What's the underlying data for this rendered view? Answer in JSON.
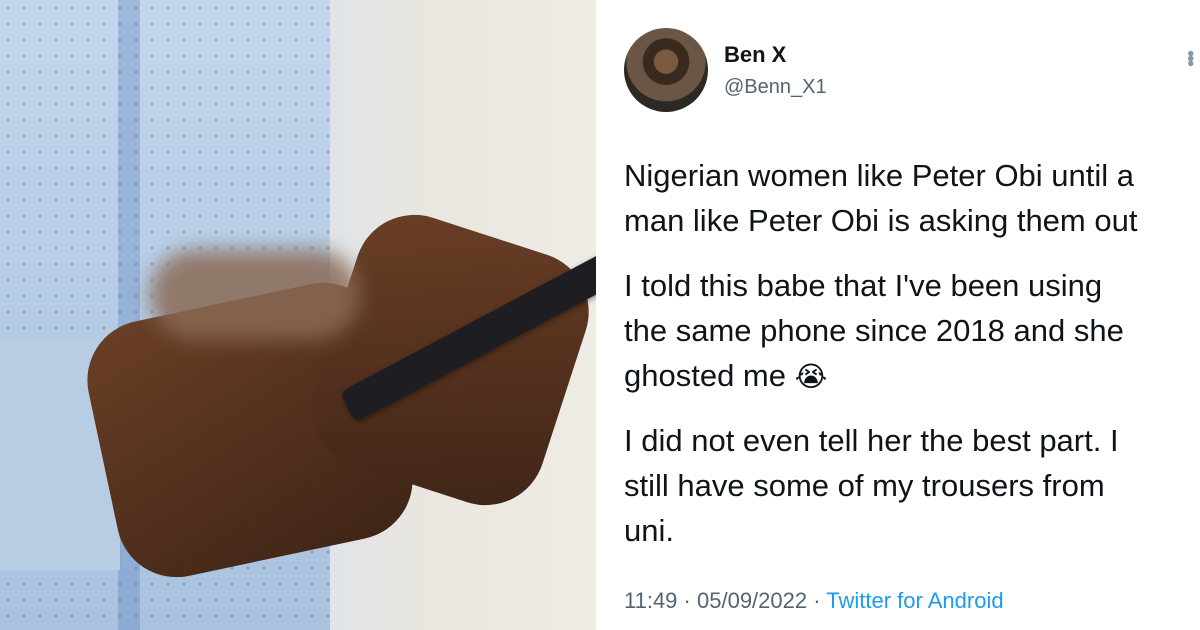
{
  "tweet": {
    "name": "Ben X",
    "handle": "@Benn_X1",
    "paragraphs": [
      [
        "Nigerian women like Peter Obi until a",
        "man like Peter Obi is asking them out"
      ],
      [
        "I told this babe that I've been using",
        "the same phone since 2018 and she",
        "ghosted me"
      ],
      [
        "I did not even tell her the best part. I",
        "still have some of my trousers from",
        "uni."
      ]
    ],
    "emoji": "😭",
    "time": "11:49",
    "separator": "·",
    "date": "05/09/2022",
    "source": "Twitter for Android"
  },
  "colors": {
    "text": "#0f1419",
    "secondary": "#536471",
    "link": "#1d9bf0"
  },
  "icons": {
    "more": "more-options-icon"
  }
}
